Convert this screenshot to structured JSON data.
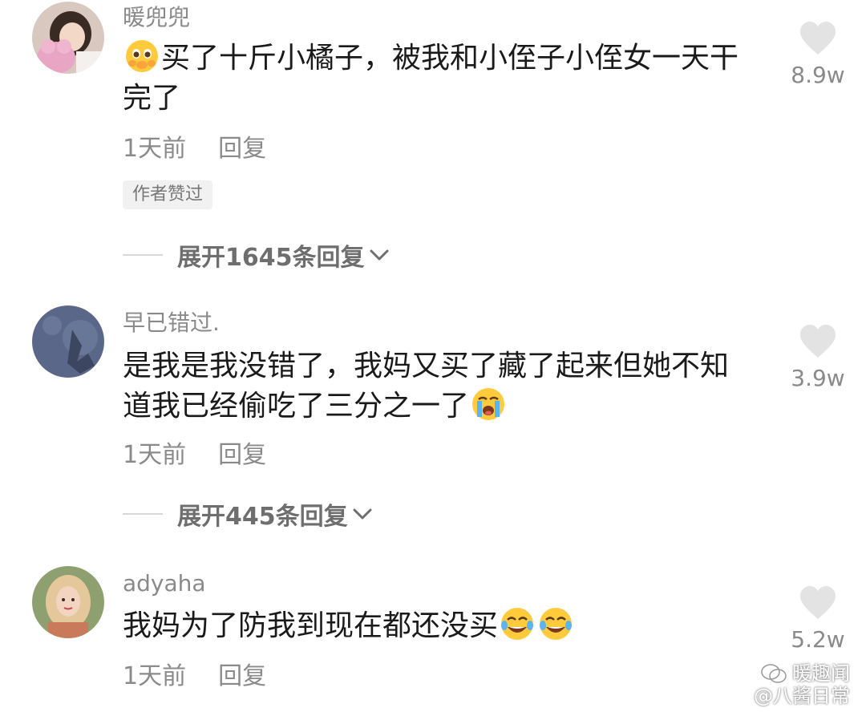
{
  "comments": [
    {
      "username": "暖兜兜",
      "text_before": "",
      "text_after": "买了十斤小橘子，被我和小侄子小侄女一天干完了",
      "emoji_lead": "pleading-face-emoji",
      "time": "1天前",
      "reply_label": "回复",
      "badge": "作者赞过",
      "expand": "展开1645条回复",
      "likes": "8.9w"
    },
    {
      "username": "早已错过.",
      "text_before": "是我是我没错了，我妈又买了藏了起来但她不知道我已经偷吃了三分之一了",
      "emoji_trail": "crying-face-emoji",
      "time": "1天前",
      "reply_label": "回复",
      "expand": "展开445条回复",
      "likes": "3.9w"
    },
    {
      "username": "adyaha",
      "text_before": "我妈为了防我到现在都还没买",
      "emoji_trail": "tears-of-joy-emoji",
      "time": "1天前",
      "reply_label": "回复",
      "likes": "5.2w"
    }
  ],
  "watermark": {
    "line1": "暖趣闻",
    "line2": "@八酱日常"
  },
  "colors": {
    "username": "#8a8a8a",
    "text": "#1a1a1a",
    "heart": "#e3e3e3",
    "badge_bg": "#f1f1f1"
  }
}
